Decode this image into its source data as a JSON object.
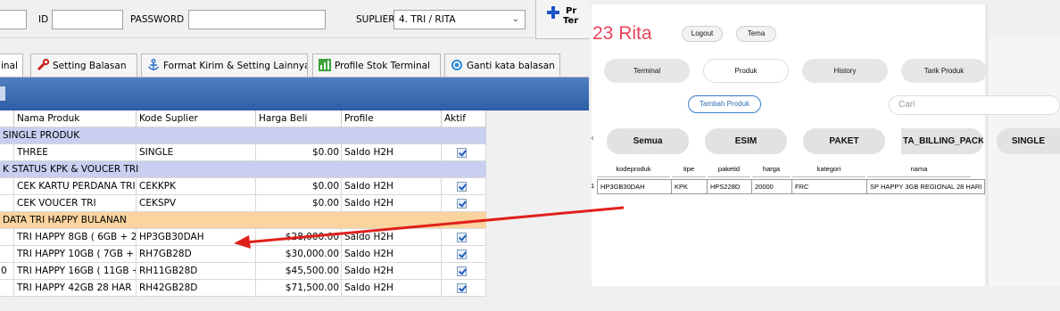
{
  "left_window": {
    "fields": {
      "id_label": "ID",
      "password_label": "PASSWORD",
      "suplier_label": "SUPLIER",
      "suplier_value": "4. TRI / RITA",
      "add_button_line1": "Pr",
      "add_button_line2": "Ter"
    },
    "tabs": [
      {
        "label": "inal"
      },
      {
        "label": "Setting Balasan"
      },
      {
        "label": "Format Kirim & Setting Lainnya"
      },
      {
        "label": "Profile Stok Terminal"
      },
      {
        "label": "Ganti kata balasan"
      }
    ],
    "grid": {
      "headers": [
        "Nama Produk",
        "Kode Suplier",
        "Harga Beli",
        "Profile",
        "Aktif"
      ],
      "rows": [
        {
          "type": "group",
          "color": "blue",
          "label": "SINGLE PRODUK"
        },
        {
          "type": "item",
          "nama": "THREE",
          "kode": "SINGLE",
          "harga": "$0.00",
          "profile": "Saldo H2H"
        },
        {
          "type": "group",
          "color": "blue",
          "label": "K STATUS KPK & VOUCER TRI"
        },
        {
          "type": "item",
          "nama": "CEK KARTU PERDANA TRI",
          "kode": "CEKKPK",
          "harga": "$0.00",
          "profile": "Saldo H2H"
        },
        {
          "type": "item",
          "nama": "CEK VOUCER TRI",
          "kode": "CEKSPV",
          "harga": "$0.00",
          "profile": "Saldo H2H"
        },
        {
          "type": "group",
          "color": "orange",
          "label": "DATA TRI HAPPY BULANAN"
        },
        {
          "type": "item",
          "nama": "TRI HAPPY 8GB ( 6GB + 2(",
          "kode": "HP3GB30DAH",
          "harga": "$28,000.00",
          "profile": "Saldo H2H"
        },
        {
          "type": "item",
          "nama": "TRI HAPPY 10GB ( 7GB + :",
          "kode": "RH7GB28D",
          "harga": "$30,000.00",
          "profile": "Saldo H2H"
        },
        {
          "type": "item",
          "nama": "TRI HAPPY 16GB ( 11GB +",
          "kode": "RH11GB28D",
          "harga": "$45,500.00",
          "profile": "Saldo H2H",
          "prefix": "0"
        },
        {
          "type": "item",
          "nama": "TRI HAPPY 42GB   28 HAR",
          "kode": "RH42GB28D",
          "harga": "$71,500.00",
          "profile": "Saldo H2H"
        }
      ]
    }
  },
  "right_window": {
    "title": "23 Rita",
    "top_buttons": {
      "logout": "Logout",
      "tema": "Tema"
    },
    "nav": [
      "Terminal",
      "Produk",
      "History",
      "Tarik Produk"
    ],
    "nav_active": "Produk",
    "add_product_button": "Tambah Produk",
    "search_placeholder": "Cari",
    "categories": [
      "Semua",
      "ESIM",
      "PAKET",
      "TA_BILLING_PACKA",
      "SINGLE"
    ],
    "table": {
      "headers": [
        "kodeproduk",
        "tipe",
        "paketid",
        "harga",
        "kategori",
        "nama"
      ],
      "row_index": "1",
      "row": [
        "HP3GB30DAH",
        "KPK",
        "HPS228D",
        "20000",
        "FRC",
        "SP HAPPY 3GB REGIONAL 28 HARI"
      ]
    }
  },
  "colors": {
    "accent_red": "#e8435a",
    "toolbar_blue": "#3a6bb3",
    "group_blue": "#c9cff0",
    "group_orange": "#fbd39e",
    "arrow": "#e0201b"
  }
}
